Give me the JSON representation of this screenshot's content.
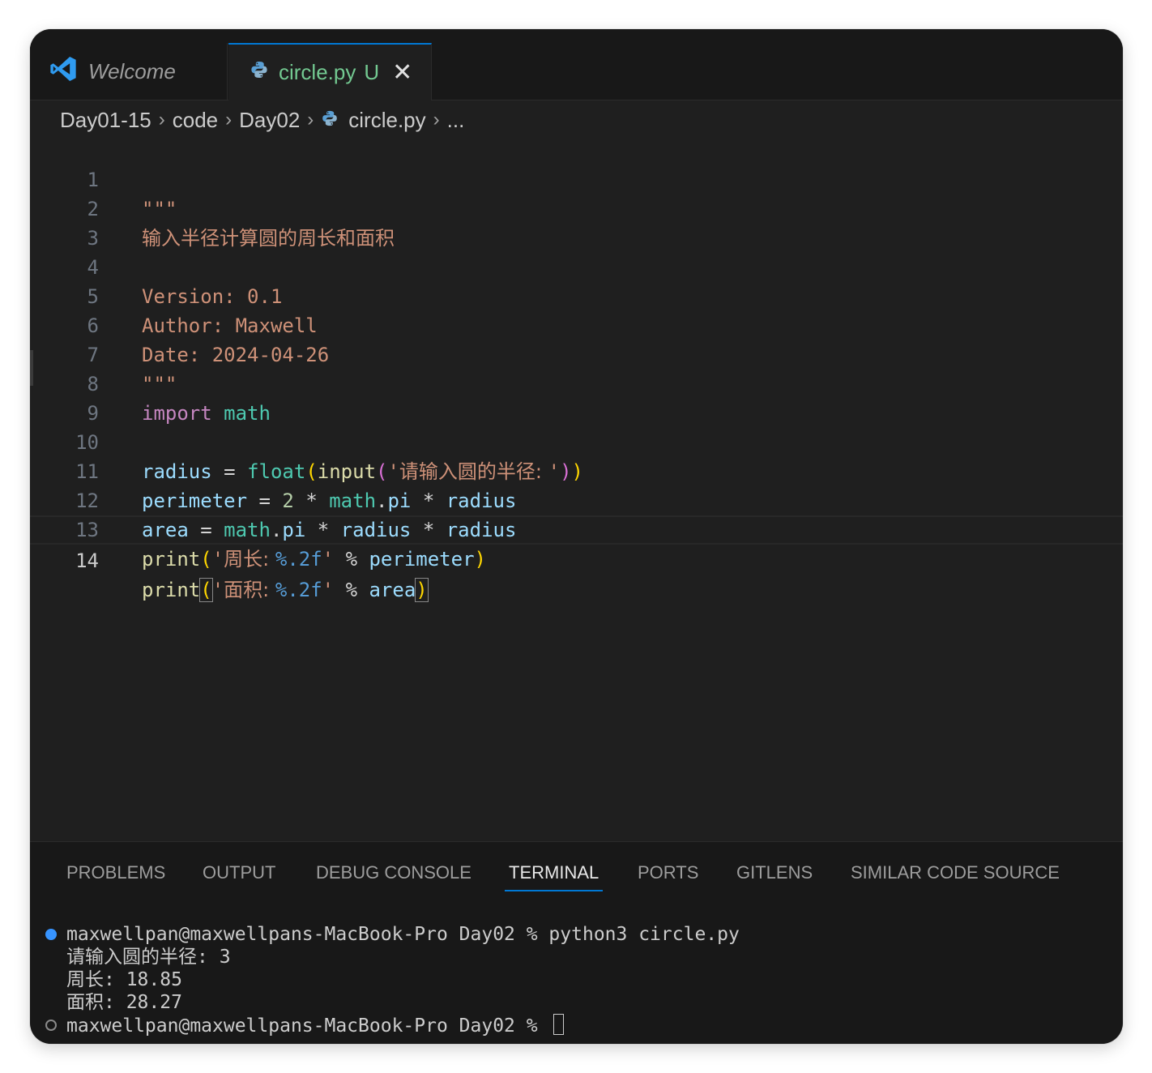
{
  "tabs": [
    {
      "label": "Welcome",
      "icon": "vscode-logo-icon"
    },
    {
      "label": "circle.py",
      "badge": "U",
      "icon": "python-icon",
      "close": "✕"
    }
  ],
  "breadcrumb": {
    "items": [
      "Day01-15",
      "code",
      "Day02",
      "circle.py",
      "..."
    ],
    "separator": "›"
  },
  "editor": {
    "active_line": 14,
    "lines": [
      {
        "n": "1"
      },
      {
        "n": "2"
      },
      {
        "n": "3"
      },
      {
        "n": "4"
      },
      {
        "n": "5"
      },
      {
        "n": "6"
      },
      {
        "n": "7"
      },
      {
        "n": "8"
      },
      {
        "n": "9"
      },
      {
        "n": "10"
      },
      {
        "n": "11"
      },
      {
        "n": "12"
      },
      {
        "n": "13"
      },
      {
        "n": "14"
      }
    ],
    "tokens": {
      "docstring_quotes": "\"\"\"",
      "doc_title": "输入半径计算圆的周长和面积",
      "doc_version": "Version: 0.1",
      "doc_author": "Author: Maxwell",
      "doc_date": "Date: 2024-04-26",
      "import_kw": "import",
      "math": "math",
      "radius": "radius",
      "perimeter": "perimeter",
      "area": "area",
      "float": "float",
      "input": "input",
      "print": "print",
      "pi": "pi",
      "eq": "=",
      "mul": "*",
      "mod_op": "%",
      "dot": ".",
      "two": "2",
      "lparen": "(",
      "rparen": ")",
      "quote": "'",
      "prompt_str": "请输入圆的半径: ",
      "perim_str": "周长: ",
      "area_str": "面积: ",
      "fmt_spec": "%.2f"
    }
  },
  "panel": {
    "tabs": [
      "PROBLEMS",
      "OUTPUT",
      "DEBUG CONSOLE",
      "TERMINAL",
      "PORTS",
      "GITLENS",
      "SIMILAR CODE SOURCE"
    ],
    "active_tab": "TERMINAL",
    "terminal": {
      "lines": [
        "maxwellpan@maxwellpans-MacBook-Pro Day02 % python3 circle.py",
        "请输入圆的半径: 3",
        "周长: 18.85",
        "面积: 28.27",
        "maxwellpan@maxwellpans-MacBook-Pro Day02 % "
      ]
    }
  },
  "colors": {
    "accent": "#0078d4",
    "untracked_green": "#73c991",
    "string": "#ce9178",
    "keyword": "#c586c0",
    "variable": "#9cdcfe",
    "function": "#dcdcaa",
    "module": "#4ec9b0",
    "number": "#b5cea8"
  }
}
